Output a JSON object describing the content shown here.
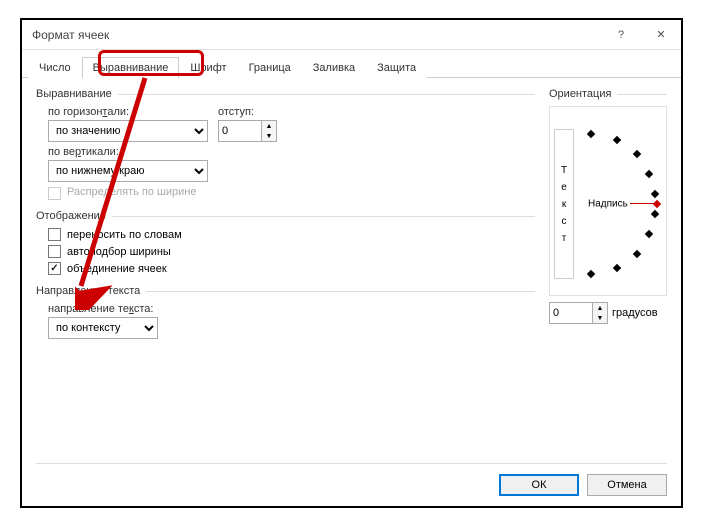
{
  "window": {
    "title": "Формат ячеек"
  },
  "tabs": [
    "Число",
    "Выравнивание",
    "Шрифт",
    "Граница",
    "Заливка",
    "Защита"
  ],
  "active_tab": 1,
  "alignment": {
    "group": "Выравнивание",
    "horizontal_label": "по горизонтали:",
    "horizontal_value": "по значению",
    "indent_label": "отступ:",
    "indent_value": "0",
    "vertical_label": "по вертикали:",
    "vertical_value": "по нижнему краю",
    "distribute_label": "Распределять по ширине"
  },
  "display": {
    "group": "Отображение",
    "wrap_label": "переносить по словам",
    "shrink_label": "автоподбор ширины",
    "merge_label": "объединение ячеек",
    "wrap": false,
    "shrink": false,
    "merge": true
  },
  "textdir": {
    "group": "Направление текста",
    "label": "направление текста:",
    "value": "по контексту"
  },
  "orient": {
    "group": "Ориентация",
    "vertical": "Текст",
    "caption": "Надпись",
    "degrees_value": "0",
    "degrees_label": "градусов"
  },
  "buttons": {
    "ok": "ОК",
    "cancel": "Отмена"
  },
  "annotation": {
    "highlight_color": "#c00"
  }
}
